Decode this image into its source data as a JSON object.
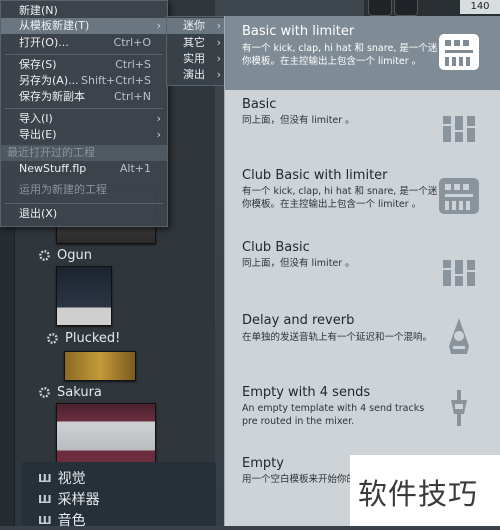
{
  "file_menu": {
    "items": [
      {
        "label": "新建(N)",
        "shortcut": ""
      },
      {
        "label": "从模板新建(T)",
        "shortcut": "",
        "arrow": "›"
      },
      {
        "label": "打开(O)...",
        "shortcut": "Ctrl+O"
      },
      {
        "label": "保存(S)",
        "shortcut": "Ctrl+S"
      },
      {
        "label": "另存为(A)...",
        "shortcut": "Shift+Ctrl+S"
      },
      {
        "label": "保存为新副本",
        "shortcut": "Ctrl+N"
      },
      {
        "label": "导入(I)",
        "shortcut": "",
        "arrow": "›"
      },
      {
        "label": "导出(E)",
        "shortcut": "",
        "arrow": "›"
      },
      {
        "label": "最近打开过的工程",
        "shortcut": ""
      },
      {
        "label": "NewStuff.flp",
        "shortcut": "Alt+1"
      },
      {
        "label": "运用为新建的工程",
        "shortcut": ""
      },
      {
        "label": "退出(X)",
        "shortcut": ""
      }
    ]
  },
  "template_submenu": {
    "items": [
      {
        "label": "迷你",
        "arrow": "›"
      },
      {
        "label": "其它",
        "arrow": "›"
      },
      {
        "label": "实用",
        "arrow": "›"
      },
      {
        "label": "演出",
        "arrow": "›"
      }
    ]
  },
  "templates": [
    {
      "title": "Basic with limiter",
      "desc": "有一个 kick, clap, hi hat 和 snare, 是一个迷你模板。在主控输出上包含一个 limiter 。",
      "icon": "mixer-limiter-icon"
    },
    {
      "title": "Basic",
      "desc": "同上面，但没有 limiter 。",
      "icon": "mixer-icon"
    },
    {
      "title": "Club Basic with limiter",
      "desc": "有一个 kick, clap, hi hat 和 snare, 是一个迷你模板。在主控输出上包含一个 limiter 。",
      "icon": "mixer-limiter-icon"
    },
    {
      "title": "Club Basic",
      "desc": "同上面，但没有 limiter 。",
      "icon": "mixer-icon"
    },
    {
      "title": "Delay and reverb",
      "desc": "在单独的发送音轨上有一个延迟和一个混响。",
      "icon": "reverb-icon"
    },
    {
      "title": "Empty with 4 sends",
      "desc": "An empty template with 4 send tracks pre routed in the mixer.",
      "icon": "send-icon"
    },
    {
      "title": "Empty",
      "desc": "用一个空白模板来开始你的工程，什么也没有。",
      "icon": ""
    }
  ],
  "browser": {
    "plugins": [
      {
        "name": "Ogun"
      },
      {
        "name": "Plucked!"
      },
      {
        "name": "Sakura"
      }
    ],
    "categories": [
      {
        "name": "视觉"
      },
      {
        "name": "采样器"
      },
      {
        "name": "音色"
      }
    ]
  },
  "watermark": "软件技巧",
  "top_counter": "140"
}
